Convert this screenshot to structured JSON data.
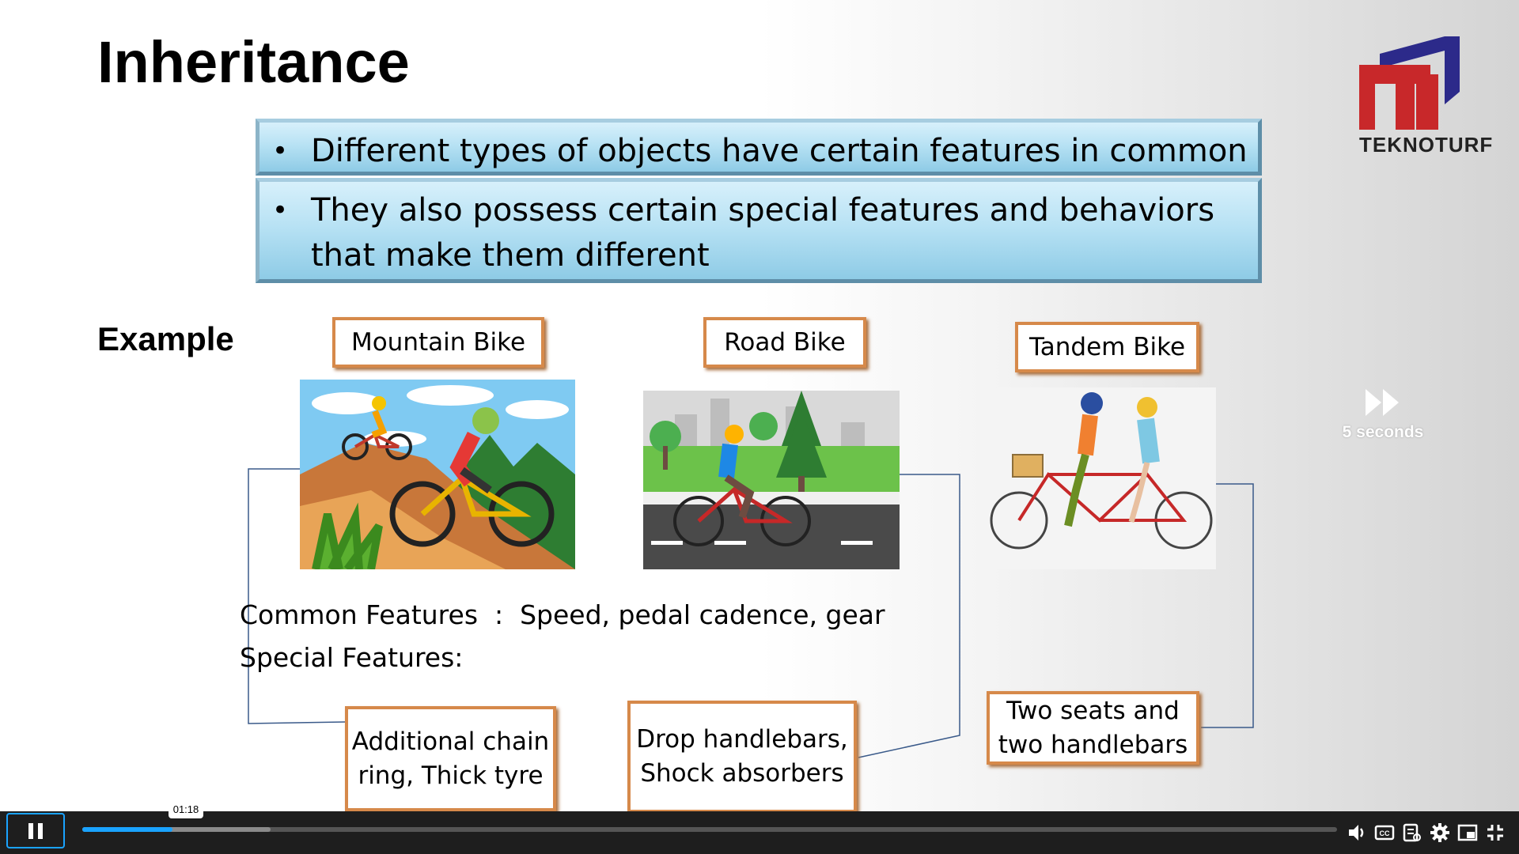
{
  "slide": {
    "title": "Inheritance",
    "logo_text": "TEKNOTURF",
    "bullets": [
      "Different types of objects have certain features in common",
      "They also possess certain special features and behaviors that make them different"
    ],
    "bullet_glyph": "•",
    "example_heading": "Example",
    "bikes": [
      {
        "label": "Mountain Bike",
        "special": "Additional chain ring, Thick tyre"
      },
      {
        "label": "Road Bike",
        "special": "Drop handlebars, Shock absorbers"
      },
      {
        "label": "Tandem Bike",
        "special": "Two seats and two handlebars"
      }
    ],
    "common_features": "Common Features  :  Speed, pedal cadence, gear",
    "special_features": "Special Features:"
  },
  "overlay": {
    "skip_label": "5 seconds",
    "skip_icon": "fast-forward-icon"
  },
  "player": {
    "state": "playing",
    "current_time": "01:18",
    "played_fraction": 0.072,
    "buffered_fraction": 0.15,
    "controls": [
      "volume-icon",
      "closed-captions-icon",
      "transcript-icon",
      "settings-icon",
      "picture-in-picture-icon",
      "exit-fullscreen-icon"
    ],
    "accent_color": "#1aa3ff"
  }
}
